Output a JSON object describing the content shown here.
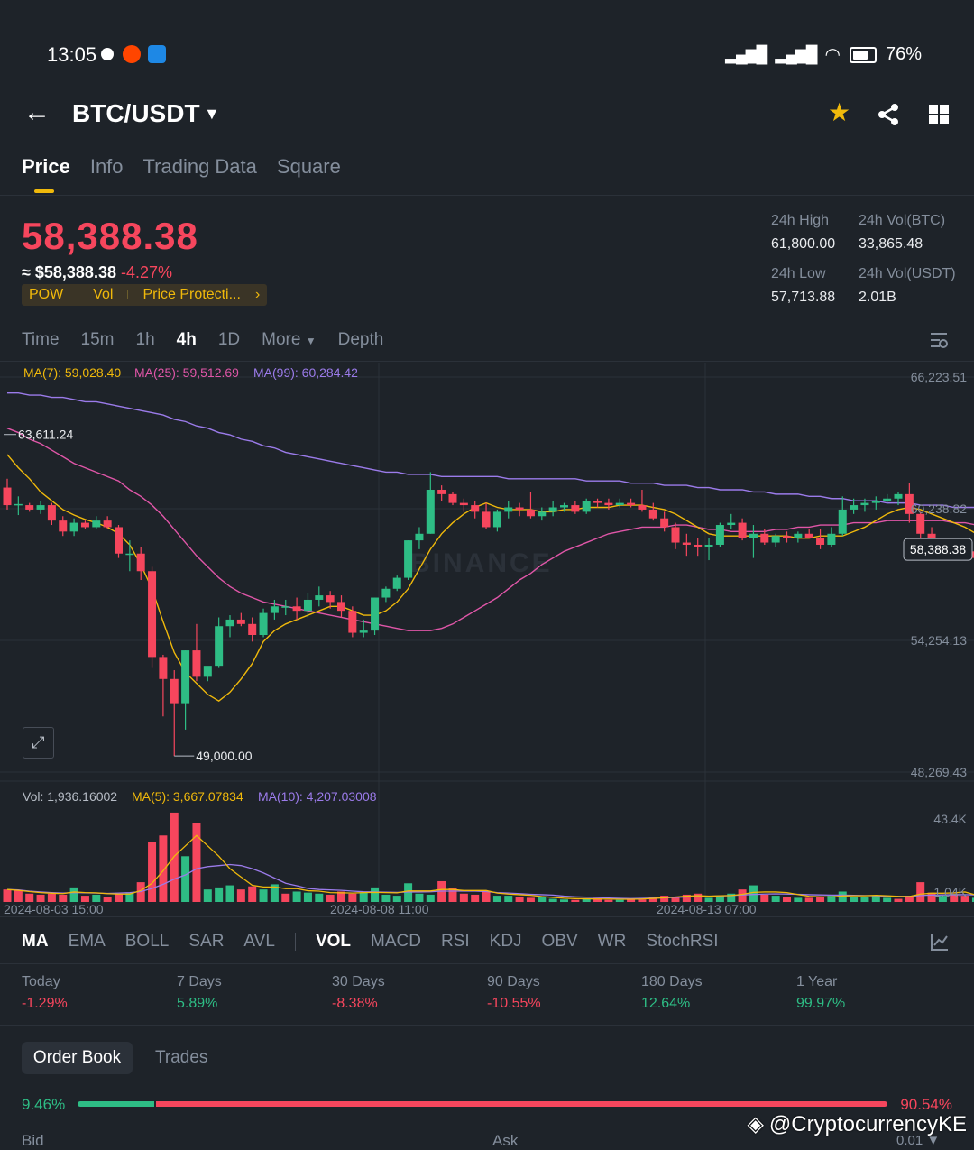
{
  "status_bar": {
    "time": "13:05",
    "battery": "76%"
  },
  "header": {
    "pair": "BTC/USDT"
  },
  "tabs": [
    "Price",
    "Info",
    "Trading Data",
    "Square"
  ],
  "price": {
    "last": "58,388.38",
    "usd": "≈ $58,388.38",
    "change": "-4.27%",
    "tags": [
      "POW",
      "Vol",
      "Price Protecti..."
    ]
  },
  "stats": {
    "high_label": "24h High",
    "high": "61,800.00",
    "low_label": "24h Low",
    "low": "57,713.88",
    "vol_btc_label": "24h Vol(BTC)",
    "vol_btc": "33,865.48",
    "vol_usdt_label": "24h Vol(USDT)",
    "vol_usdt": "2.01B"
  },
  "intervals": [
    "Time",
    "15m",
    "1h",
    "4h",
    "1D",
    "More",
    "Depth"
  ],
  "chart_data": {
    "type": "candlestick",
    "pair": "BTC/USDT",
    "interval": "4h",
    "ma_legend": {
      "ma7": "MA(7): 59,028.40",
      "ma25": "MA(25): 59,512.69",
      "ma99": "MA(99): 60,284.42"
    },
    "y_ticks": [
      "66,223.51",
      "60,238.82",
      "54,254.13",
      "48,269.43"
    ],
    "ylim": [
      48269.43,
      66223.51
    ],
    "current_price_label": "58,388.38",
    "high_marker": "63,611.24",
    "low_marker": "49,000.00",
    "x_ticks": [
      "2024-08-03 15:00",
      "2024-08-08 11:00",
      "2024-08-13 07:00"
    ],
    "watermark": "BINANCE",
    "candles": [
      {
        "o": 61200,
        "h": 61600,
        "l": 60200,
        "c": 60400
      },
      {
        "o": 60400,
        "h": 60800,
        "l": 59950,
        "c": 60450
      },
      {
        "o": 60400,
        "h": 60500,
        "l": 60100,
        "c": 60200
      },
      {
        "o": 60200,
        "h": 60600,
        "l": 60000,
        "c": 60400
      },
      {
        "o": 60400,
        "h": 60500,
        "l": 59500,
        "c": 59700
      },
      {
        "o": 59700,
        "h": 59900,
        "l": 59000,
        "c": 59200
      },
      {
        "o": 59200,
        "h": 59800,
        "l": 59000,
        "c": 59600
      },
      {
        "o": 59600,
        "h": 59700,
        "l": 59300,
        "c": 59400
      },
      {
        "o": 59400,
        "h": 59900,
        "l": 59300,
        "c": 59700
      },
      {
        "o": 59700,
        "h": 59900,
        "l": 59300,
        "c": 59400
      },
      {
        "o": 59400,
        "h": 59500,
        "l": 58000,
        "c": 58200
      },
      {
        "o": 58200,
        "h": 58800,
        "l": 57400,
        "c": 58200
      },
      {
        "o": 58200,
        "h": 58500,
        "l": 57000,
        "c": 57400
      },
      {
        "o": 57400,
        "h": 57600,
        "l": 53000,
        "c": 53500
      },
      {
        "o": 53500,
        "h": 53600,
        "l": 50800,
        "c": 52500
      },
      {
        "o": 52500,
        "h": 52900,
        "l": 49000,
        "c": 51400
      },
      {
        "o": 51400,
        "h": 53800,
        "l": 50200,
        "c": 53800
      },
      {
        "o": 53800,
        "h": 55000,
        "l": 52400,
        "c": 52600
      },
      {
        "o": 52600,
        "h": 53000,
        "l": 52400,
        "c": 53100
      },
      {
        "o": 53100,
        "h": 55300,
        "l": 53000,
        "c": 54900
      },
      {
        "o": 54900,
        "h": 55400,
        "l": 54400,
        "c": 55200
      },
      {
        "o": 55200,
        "h": 55500,
        "l": 54900,
        "c": 55000
      },
      {
        "o": 55000,
        "h": 55300,
        "l": 54200,
        "c": 54500
      },
      {
        "o": 54500,
        "h": 55700,
        "l": 54400,
        "c": 55500
      },
      {
        "o": 55500,
        "h": 56100,
        "l": 55200,
        "c": 55800
      },
      {
        "o": 55800,
        "h": 56100,
        "l": 55400,
        "c": 55800
      },
      {
        "o": 55800,
        "h": 56200,
        "l": 55200,
        "c": 55600
      },
      {
        "o": 55600,
        "h": 56400,
        "l": 55300,
        "c": 56100
      },
      {
        "o": 56100,
        "h": 56700,
        "l": 55800,
        "c": 56300
      },
      {
        "o": 56300,
        "h": 56500,
        "l": 55700,
        "c": 56000
      },
      {
        "o": 56000,
        "h": 56300,
        "l": 55300,
        "c": 55600
      },
      {
        "o": 55600,
        "h": 55800,
        "l": 54400,
        "c": 54600
      },
      {
        "o": 54600,
        "h": 55200,
        "l": 54400,
        "c": 54700
      },
      {
        "o": 54700,
        "h": 56200,
        "l": 54500,
        "c": 56200
      },
      {
        "o": 56200,
        "h": 56700,
        "l": 56000,
        "c": 56600
      },
      {
        "o": 56600,
        "h": 57200,
        "l": 56500,
        "c": 57100
      },
      {
        "o": 57100,
        "h": 58800,
        "l": 57000,
        "c": 58800
      },
      {
        "o": 58800,
        "h": 59400,
        "l": 58400,
        "c": 59100
      },
      {
        "o": 59100,
        "h": 61900,
        "l": 59100,
        "c": 61100
      },
      {
        "o": 61100,
        "h": 61300,
        "l": 60600,
        "c": 60900
      },
      {
        "o": 60900,
        "h": 61000,
        "l": 60400,
        "c": 60500
      },
      {
        "o": 60500,
        "h": 60700,
        "l": 60100,
        "c": 60400
      },
      {
        "o": 60400,
        "h": 60600,
        "l": 59800,
        "c": 60100
      },
      {
        "o": 60100,
        "h": 60500,
        "l": 59300,
        "c": 59400
      },
      {
        "o": 59400,
        "h": 60200,
        "l": 59200,
        "c": 60100
      },
      {
        "o": 60100,
        "h": 60600,
        "l": 59800,
        "c": 60300
      },
      {
        "o": 60300,
        "h": 60500,
        "l": 59900,
        "c": 60200
      },
      {
        "o": 60200,
        "h": 61000,
        "l": 59800,
        "c": 59900
      },
      {
        "o": 59900,
        "h": 60300,
        "l": 59700,
        "c": 60100
      },
      {
        "o": 60100,
        "h": 60600,
        "l": 59900,
        "c": 60300
      },
      {
        "o": 60300,
        "h": 60500,
        "l": 60100,
        "c": 60400
      },
      {
        "o": 60400,
        "h": 60600,
        "l": 60000,
        "c": 60100
      },
      {
        "o": 60100,
        "h": 60700,
        "l": 60000,
        "c": 60600
      },
      {
        "o": 60600,
        "h": 60700,
        "l": 60300,
        "c": 60500
      },
      {
        "o": 60500,
        "h": 60700,
        "l": 60200,
        "c": 60400
      },
      {
        "o": 60400,
        "h": 60700,
        "l": 60300,
        "c": 60500
      },
      {
        "o": 60500,
        "h": 60700,
        "l": 60300,
        "c": 60400
      },
      {
        "o": 60400,
        "h": 61100,
        "l": 60100,
        "c": 60200
      },
      {
        "o": 60200,
        "h": 60500,
        "l": 59700,
        "c": 59800
      },
      {
        "o": 59800,
        "h": 60100,
        "l": 59200,
        "c": 59400
      },
      {
        "o": 59400,
        "h": 59600,
        "l": 58400,
        "c": 58700
      },
      {
        "o": 58700,
        "h": 59100,
        "l": 58100,
        "c": 58600
      },
      {
        "o": 58600,
        "h": 58900,
        "l": 58100,
        "c": 58500
      },
      {
        "o": 58500,
        "h": 58900,
        "l": 57900,
        "c": 58600
      },
      {
        "o": 58600,
        "h": 59600,
        "l": 58500,
        "c": 59500
      },
      {
        "o": 59500,
        "h": 60000,
        "l": 59300,
        "c": 59600
      },
      {
        "o": 59600,
        "h": 59800,
        "l": 58800,
        "c": 58900
      },
      {
        "o": 58900,
        "h": 59500,
        "l": 58000,
        "c": 59100
      },
      {
        "o": 59100,
        "h": 59300,
        "l": 58600,
        "c": 58700
      },
      {
        "o": 58700,
        "h": 59100,
        "l": 58500,
        "c": 59000
      },
      {
        "o": 59000,
        "h": 59200,
        "l": 58700,
        "c": 58900
      },
      {
        "o": 58900,
        "h": 59200,
        "l": 58700,
        "c": 59100
      },
      {
        "o": 59100,
        "h": 59300,
        "l": 58900,
        "c": 58900
      },
      {
        "o": 58900,
        "h": 59300,
        "l": 58400,
        "c": 58600
      },
      {
        "o": 58600,
        "h": 59400,
        "l": 58500,
        "c": 59100
      },
      {
        "o": 59100,
        "h": 60800,
        "l": 59000,
        "c": 60200
      },
      {
        "o": 60200,
        "h": 60700,
        "l": 60000,
        "c": 60400
      },
      {
        "o": 60400,
        "h": 60700,
        "l": 60100,
        "c": 60500
      },
      {
        "o": 60500,
        "h": 60800,
        "l": 60200,
        "c": 60600
      },
      {
        "o": 60600,
        "h": 60900,
        "l": 60500,
        "c": 60700
      },
      {
        "o": 60700,
        "h": 61000,
        "l": 60400,
        "c": 60900
      },
      {
        "o": 60900,
        "h": 61400,
        "l": 59600,
        "c": 60000
      },
      {
        "o": 60000,
        "h": 60100,
        "l": 58800,
        "c": 59100
      },
      {
        "o": 59100,
        "h": 59400,
        "l": 58700,
        "c": 58800
      },
      {
        "o": 58800,
        "h": 58900,
        "l": 58300,
        "c": 58500
      },
      {
        "o": 58500,
        "h": 58800,
        "l": 58200,
        "c": 58700
      },
      {
        "o": 58700,
        "h": 58800,
        "l": 58100,
        "c": 58300
      },
      {
        "o": 58300,
        "h": 58500,
        "l": 57800,
        "c": 58000
      },
      {
        "o": 58000,
        "h": 58400,
        "l": 57700,
        "c": 58200
      },
      {
        "o": 58200,
        "h": 58600,
        "l": 57900,
        "c": 58388
      }
    ],
    "ma7_points": [
      62700,
      62100,
      61600,
      61000,
      60600,
      60200,
      59950,
      59750,
      59600,
      59400,
      59100,
      58600,
      57700,
      56600,
      55100,
      53700,
      52800,
      52300,
      51800,
      51500,
      51900,
      52500,
      53200,
      54200,
      54700,
      55000,
      55200,
      55400,
      55600,
      55800,
      55800,
      55600,
      55400,
      55400,
      55600,
      56000,
      56600,
      57500,
      58400,
      59100,
      59600,
      60000,
      60300,
      60500,
      60300,
      60200,
      60200,
      60200,
      60100,
      60100,
      60200,
      60200,
      60300,
      60300,
      60300,
      60400,
      60400,
      60400,
      60300,
      60200,
      60000,
      59700,
      59400,
      59100,
      59000,
      59000,
      59000,
      59000,
      59000,
      59000,
      59000,
      58900,
      58900,
      59000,
      59000,
      59000,
      59200,
      59400,
      59700,
      60000,
      60200,
      60300,
      60200,
      60000,
      59800,
      59600,
      59400,
      59100,
      58800,
      58500
    ],
    "ma25_points": [
      63900,
      63700,
      63400,
      63200,
      62900,
      62600,
      62300,
      62100,
      61900,
      61700,
      61500,
      61100,
      60800,
      60400,
      59900,
      59300,
      58700,
      58100,
      57600,
      57100,
      56700,
      56400,
      56200,
      56000,
      55900,
      55800,
      55700,
      55600,
      55500,
      55400,
      55300,
      55200,
      55100,
      55000,
      54900,
      54800,
      54700,
      54700,
      54700,
      54800,
      55000,
      55300,
      55600,
      55900,
      56200,
      56600,
      57000,
      57300,
      57700,
      58000,
      58300,
      58500,
      58700,
      58900,
      59100,
      59200,
      59300,
      59400,
      59400,
      59400,
      59500,
      59500,
      59400,
      59300,
      59300,
      59200,
      59200,
      59200,
      59200,
      59300,
      59300,
      59400,
      59400,
      59500,
      59500,
      59500,
      59600,
      59600,
      59600,
      59700,
      59700,
      59700,
      59700,
      59700,
      59700,
      59600,
      59600,
      59500,
      59500,
      59400
    ],
    "ma99_points": [
      65500,
      65500,
      65400,
      65400,
      65300,
      65300,
      65200,
      65100,
      65100,
      65000,
      64900,
      64800,
      64700,
      64600,
      64500,
      64300,
      64200,
      64000,
      63900,
      63700,
      63600,
      63400,
      63300,
      63100,
      63000,
      62800,
      62700,
      62600,
      62500,
      62400,
      62300,
      62200,
      62100,
      62000,
      61900,
      61900,
      61800,
      61800,
      61800,
      61700,
      61700,
      61700,
      61700,
      61700,
      61700,
      61600,
      61600,
      61600,
      61600,
      61600,
      61600,
      61600,
      61500,
      61500,
      61500,
      61500,
      61400,
      61400,
      61400,
      61300,
      61300,
      61300,
      61200,
      61200,
      61100,
      61100,
      61100,
      61000,
      61000,
      60900,
      60900,
      60900,
      60800,
      60800,
      60700,
      60700,
      60600,
      60600,
      60600,
      60500,
      60500,
      60500,
      60400,
      60400,
      60400,
      60300,
      60300,
      60300,
      60300,
      60200
    ],
    "volume": {
      "legend": {
        "vol": "Vol: 1,936.16002",
        "ma5": "MA(5): 3,667.07834",
        "ma10": "MA(10): 4,207.03008"
      },
      "y_ticks": [
        "43.4K",
        "1.04K"
      ],
      "ylim": [
        0,
        43400
      ],
      "values": [
        6000,
        5500,
        4000,
        3500,
        4000,
        3500,
        7000,
        3000,
        3500,
        2500,
        4000,
        4500,
        9500,
        29000,
        32000,
        43000,
        22000,
        38000,
        6000,
        7000,
        8000,
        6000,
        7500,
        6000,
        8500,
        4000,
        5000,
        4500,
        4000,
        3500,
        5000,
        4000,
        4500,
        7000,
        3500,
        3000,
        9000,
        4000,
        3500,
        10000,
        6500,
        4000,
        3500,
        5000,
        3000,
        3000,
        2500,
        2000,
        2500,
        1500,
        1200,
        1000,
        1500,
        1800,
        1000,
        1000,
        1200,
        1200,
        2500,
        3000,
        2500,
        3500,
        4000,
        2000,
        3000,
        4000,
        6000,
        8000,
        3500,
        3000,
        2500,
        2000,
        2000,
        2500,
        3000,
        5000,
        2500,
        2500,
        3000,
        2000,
        1500,
        3000,
        9500,
        4500,
        3000,
        4000,
        3000,
        2000,
        1800,
        1900
      ],
      "ma5_points": [
        6000,
        5600,
        5000,
        4500,
        4200,
        4000,
        4800,
        4500,
        4400,
        4000,
        3800,
        3800,
        5500,
        9000,
        15000,
        22000,
        27000,
        32000,
        27000,
        22000,
        16000,
        12000,
        8000,
        7200,
        7200,
        6400,
        6400,
        5400,
        5200,
        4500,
        4400,
        4300,
        4500,
        4600,
        4500,
        4400,
        5300,
        5300,
        5300,
        6000,
        6000,
        5500,
        5500,
        5500,
        4300,
        3800,
        3500,
        3200,
        2600,
        2200,
        1800,
        1600,
        1500,
        1400,
        1400,
        1300,
        1300,
        1400,
        1700,
        2000,
        2400,
        2800,
        3000,
        2800,
        3000,
        3100,
        3700,
        4600,
        4800,
        4800,
        4500,
        3600,
        2700,
        2500,
        2400,
        2900,
        3000,
        3000,
        3200,
        3000,
        2700,
        2600,
        3800,
        4200,
        4200,
        4400,
        4800,
        3300,
        3000,
        2700
      ],
      "ma10_points": [
        6000,
        5800,
        5200,
        4800,
        4500,
        4300,
        4500,
        4400,
        4300,
        4100,
        4300,
        4500,
        5000,
        6500,
        8500,
        11000,
        13000,
        16000,
        17000,
        17500,
        18000,
        17500,
        16000,
        14000,
        11500,
        9000,
        7800,
        6500,
        6000,
        5800,
        5600,
        5200,
        4900,
        4800,
        4700,
        4600,
        4800,
        4800,
        4900,
        5200,
        5200,
        5200,
        5200,
        5000,
        4500,
        4300,
        4000,
        3700,
        3500,
        3300,
        2800,
        2500,
        2300,
        2100,
        1900,
        1700,
        1600,
        1700,
        1900,
        2000,
        2200,
        2400,
        2600,
        2700,
        2900,
        3100,
        3400,
        3600,
        3800,
        3900,
        3800,
        3700,
        3500,
        3400,
        3300,
        3300,
        3200,
        3100,
        3000,
        2800,
        2700,
        2700,
        3100,
        3300,
        3400,
        3500,
        3500,
        3400,
        3300,
        3200
      ],
      "colors": [
        1,
        1,
        1,
        1,
        1,
        1,
        0,
        1,
        0,
        1,
        1,
        0,
        1,
        1,
        1,
        1,
        0,
        1,
        0,
        0,
        0,
        1,
        1,
        0,
        0,
        1,
        0,
        0,
        0,
        1,
        1,
        1,
        0,
        0,
        0,
        0,
        0,
        0,
        0,
        1,
        1,
        1,
        1,
        1,
        0,
        0,
        1,
        1,
        0,
        0,
        0,
        1,
        0,
        1,
        1,
        0,
        1,
        1,
        1,
        1,
        1,
        1,
        1,
        0,
        0,
        0,
        1,
        0,
        1,
        0,
        1,
        0,
        1,
        1,
        0,
        0,
        0,
        0,
        0,
        0,
        1,
        1,
        1,
        1,
        0,
        1,
        1,
        0,
        0,
        0
      ]
    }
  },
  "indicators": [
    "MA",
    "EMA",
    "BOLL",
    "SAR",
    "AVL",
    "VOL",
    "MACD",
    "RSI",
    "KDJ",
    "OBV",
    "WR",
    "StochRSI"
  ],
  "performance": [
    {
      "label": "Today",
      "value": "-1.29%"
    },
    {
      "label": "7 Days",
      "value": "5.89%"
    },
    {
      "label": "30 Days",
      "value": "-8.38%"
    },
    {
      "label": "90 Days",
      "value": "-10.55%"
    },
    {
      "label": "180 Days",
      "value": "12.64%"
    },
    {
      "label": "1 Year",
      "value": "99.97%"
    }
  ],
  "order_book": {
    "tabs": [
      "Order Book",
      "Trades"
    ],
    "bid_pct": "9.46%",
    "ask_pct": "90.54%",
    "bid_ratio": 0.0946,
    "bid_label": "Bid",
    "ask_label": "Ask",
    "precision": "0.01"
  },
  "overlay_watermark": "@CryptocurrencyKE"
}
